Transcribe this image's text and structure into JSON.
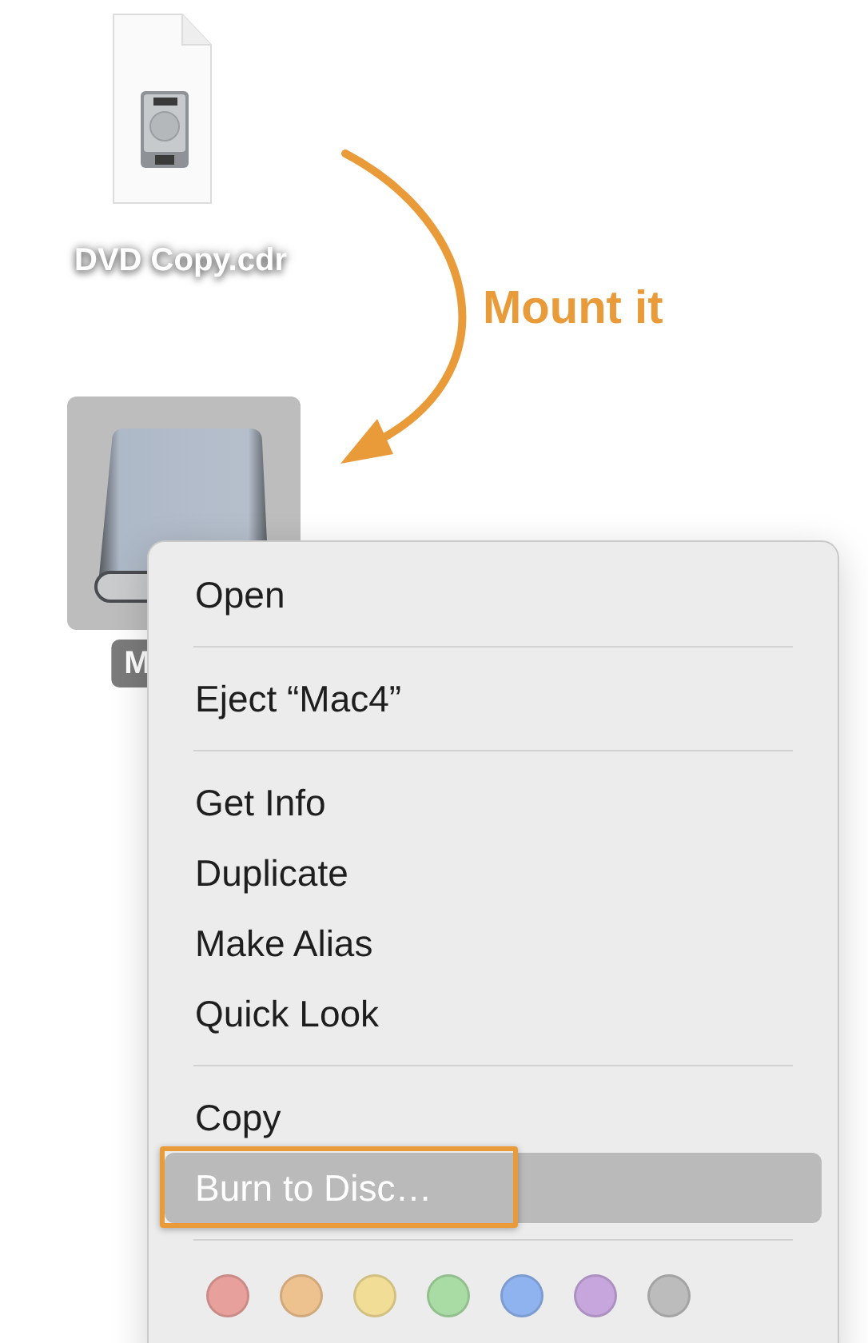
{
  "desktop_icons": [
    {
      "kind": "disk-image",
      "label": "DVD Copy.cdr",
      "selected": false
    },
    {
      "kind": "drive",
      "label": "M",
      "selected": true
    }
  ],
  "annotation": {
    "text": "Mount it"
  },
  "context_menu": {
    "sections": [
      [
        {
          "label": "Open",
          "selected": false
        }
      ],
      [
        {
          "label": "Eject “Mac4”",
          "selected": false
        }
      ],
      [
        {
          "label": "Get Info",
          "selected": false
        },
        {
          "label": "Duplicate",
          "selected": false
        },
        {
          "label": "Make Alias",
          "selected": false
        },
        {
          "label": "Quick Look",
          "selected": false
        }
      ],
      [
        {
          "label": "Copy",
          "selected": false
        },
        {
          "label": "Burn to Disc…",
          "selected": true,
          "callout": true
        }
      ]
    ],
    "tags": [
      {
        "color": "#e8a09c"
      },
      {
        "color": "#eec28f"
      },
      {
        "color": "#f1dd96"
      },
      {
        "color": "#a9dca4"
      },
      {
        "color": "#8fb3ef"
      },
      {
        "color": "#c6a6dc"
      },
      {
        "color": "#bcbcbc"
      }
    ]
  }
}
